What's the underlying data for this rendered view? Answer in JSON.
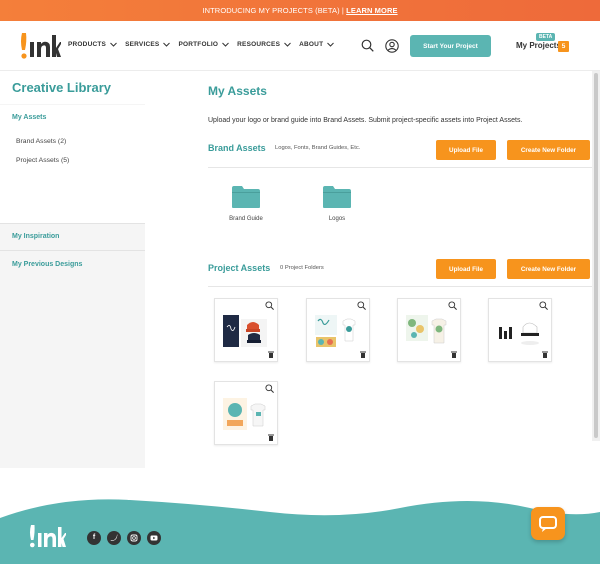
{
  "promo": {
    "text": "INTRODUCING MY PROJECTS (BETA) | ",
    "link": "LEARN MORE"
  },
  "nav": {
    "menu": [
      "PRODUCTS",
      "SERVICES",
      "PORTFOLIO",
      "RESOURCES",
      "ABOUT"
    ],
    "start_label": "Start Your Project",
    "my_projects_label": "My Projects",
    "beta_badge": "BETA",
    "project_count": "5"
  },
  "sidebar": {
    "title": "Creative Library",
    "my_assets": "My Assets",
    "brand_assets": "Brand Assets (2)",
    "project_assets": "Project Assets (5)",
    "my_inspiration": "My Inspiration",
    "previous_designs": "My Previous Designs"
  },
  "main": {
    "title": "My Assets",
    "intro": "Upload your logo or brand guide into Brand Assets. Submit project-specific assets into Project Assets.",
    "brand": {
      "title": "Brand Assets",
      "note": "Logos, Fonts, Brand Guides, Etc.",
      "upload": "Upload File",
      "create": "Create New Folder",
      "folders": [
        "Brand Guide",
        "Logos"
      ]
    },
    "project": {
      "title": "Project Assets",
      "note": "0 Project Folders",
      "upload": "Upload File",
      "create": "Create New Folder"
    }
  },
  "colors": {
    "teal": "#5bb5b2",
    "orange": "#f7941d",
    "dark": "#333333"
  }
}
